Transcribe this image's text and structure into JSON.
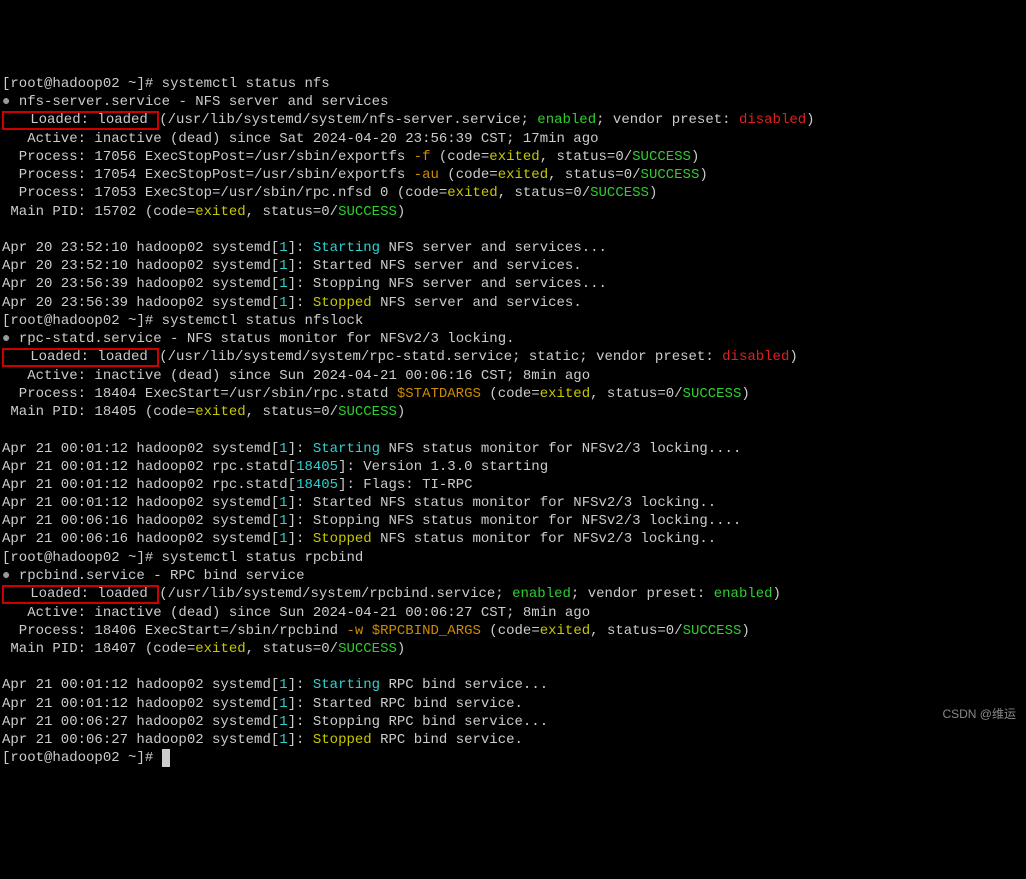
{
  "prompt_user": "root",
  "prompt_host": "hadoop02",
  "prompt_cwd": "~",
  "prompt_symbol": "#",
  "cmd1": "systemctl status nfs",
  "cmd2": "systemctl status nfslock",
  "cmd3": "systemctl status rpcbind",
  "svc1": {
    "name": "nfs-server.service",
    "desc": " - NFS server and services",
    "loaded_label": "   Loaded: loaded ",
    "loaded_rest": "(/usr/lib/systemd/system/nfs-server.service; ",
    "enabled": "enabled",
    "vendor": "; vendor preset: ",
    "vendor_preset": "disabled",
    "end": ")",
    "active": "   Active: inactive (dead) since Sat 2024-04-20 23:56:39 CST; 17min ago",
    "p1a": "  Process: 17056 ExecStopPost=/usr/sbin/exportfs ",
    "p1flag": "-f",
    "p1b": " (code=",
    "p1ex": "exited",
    "p1c": ", status=0/",
    "p1s": "SUCCESS",
    "p1d": ")",
    "p2a": "  Process: 17054 ExecStopPost=/usr/sbin/exportfs ",
    "p2flag": "-au",
    "p2b": " (code=",
    "p2ex": "exited",
    "p2c": ", status=0/",
    "p2s": "SUCCESS",
    "p2d": ")",
    "p3a": "  Process: 17053 ExecStop=/usr/sbin/rpc.nfsd 0 (code=",
    "p3ex": "exited",
    "p3c": ", status=0/",
    "p3s": "SUCCESS",
    "p3d": ")",
    "pida": " Main PID: 15702 (code=",
    "pidex": "exited",
    "pidc": ", status=0/",
    "pids": "SUCCESS",
    "pidd": ")",
    "log": [
      {
        "t": "Apr 20 23:52:10 hadoop02 systemd[",
        "n": "1",
        "m": "]: ",
        "a": "Starting",
        "r": " NFS server and services..."
      },
      {
        "t": "Apr 20 23:52:10 hadoop02 systemd[",
        "n": "1",
        "m": "]: Started NFS server and services.",
        "plain": true
      },
      {
        "t": "Apr 20 23:56:39 hadoop02 systemd[",
        "n": "1",
        "m": "]: Stopping NFS server and services...",
        "plain": true
      },
      {
        "t": "Apr 20 23:56:39 hadoop02 systemd[",
        "n": "1",
        "m": "]: ",
        "a": "Stopped",
        "r": " NFS server and services.",
        "stop": true
      }
    ]
  },
  "svc2": {
    "name": "rpc-statd.service",
    "desc": " - NFS status monitor for NFSv2/3 locking.",
    "loaded_label": "   Loaded: loaded ",
    "loaded_rest": "(/usr/lib/systemd/system/rpc-statd.service; static; vendor preset: ",
    "vendor_preset": "disabled",
    "end": ")",
    "active": "   Active: inactive (dead) since Sun 2024-04-21 00:06:16 CST; 8min ago",
    "p1a": "  Process: 18404 ExecStart=/usr/sbin/rpc.statd ",
    "p1flag": "$STATDARGS",
    "p1b": " (code=",
    "p1ex": "exited",
    "p1c": ", status=0/",
    "p1s": "SUCCESS",
    "p1d": ")",
    "pida": " Main PID: 18405 (code=",
    "pidex": "exited",
    "pidc": ", status=0/",
    "pids": "SUCCESS",
    "pidd": ")",
    "log": [
      {
        "t": "Apr 21 00:01:12 hadoop02 systemd[",
        "n": "1",
        "m": "]: ",
        "a": "Starting",
        "r": " NFS status monitor for NFSv2/3 locking...."
      },
      {
        "t": "Apr 21 00:01:12 hadoop02 rpc.statd[",
        "n": "18405",
        "m": "]: Version 1.3.0 starting",
        "plain": true
      },
      {
        "t": "Apr 21 00:01:12 hadoop02 rpc.statd[",
        "n": "18405",
        "m": "]: Flags: TI-RPC",
        "plain": true
      },
      {
        "t": "Apr 21 00:01:12 hadoop02 systemd[",
        "n": "1",
        "m": "]: Started NFS status monitor for NFSv2/3 locking..",
        "plain": true
      },
      {
        "t": "Apr 21 00:06:16 hadoop02 systemd[",
        "n": "1",
        "m": "]: Stopping NFS status monitor for NFSv2/3 locking....",
        "plain": true
      },
      {
        "t": "Apr 21 00:06:16 hadoop02 systemd[",
        "n": "1",
        "m": "]: ",
        "a": "Stopped",
        "r": " NFS status monitor for NFSv2/3 locking..",
        "stop": true
      }
    ]
  },
  "svc3": {
    "name": "rpcbind.service",
    "desc": " - RPC bind service",
    "loaded_label": "   Loaded: loaded ",
    "loaded_rest": "(/usr/lib/systemd/system/rpcbind.service; ",
    "enabled": "enabled",
    "vendor": "; vendor preset: ",
    "vendor_preset": "enabled",
    "end": ")",
    "active": "   Active: inactive (dead) since Sun 2024-04-21 00:06:27 CST; 8min ago",
    "p1a": "  Process: 18406 ExecStart=/sbin/rpcbind ",
    "p1flag": "-w",
    "p1b": " ",
    "p1arg": "$RPCBIND_ARGS",
    "p1c": " (code=",
    "p1ex": "exited",
    "p1d": ", status=0/",
    "p1s": "SUCCESS",
    "p1e": ")",
    "pida": " Main PID: 18407 (code=",
    "pidex": "exited",
    "pidc": ", status=0/",
    "pids": "SUCCESS",
    "pidd": ")",
    "log": [
      {
        "t": "Apr 21 00:01:12 hadoop02 systemd[",
        "n": "1",
        "m": "]: ",
        "a": "Starting",
        "r": " RPC bind service..."
      },
      {
        "t": "Apr 21 00:01:12 hadoop02 systemd[",
        "n": "1",
        "m": "]: Started RPC bind service.",
        "plain": true
      },
      {
        "t": "Apr 21 00:06:27 hadoop02 systemd[",
        "n": "1",
        "m": "]: Stopping RPC bind service...",
        "plain": true
      },
      {
        "t": "Apr 21 00:06:27 hadoop02 systemd[",
        "n": "1",
        "m": "]: ",
        "a": "Stopped",
        "r": " RPC bind service.",
        "stop": true
      }
    ]
  },
  "watermark": "CSDN @维运"
}
